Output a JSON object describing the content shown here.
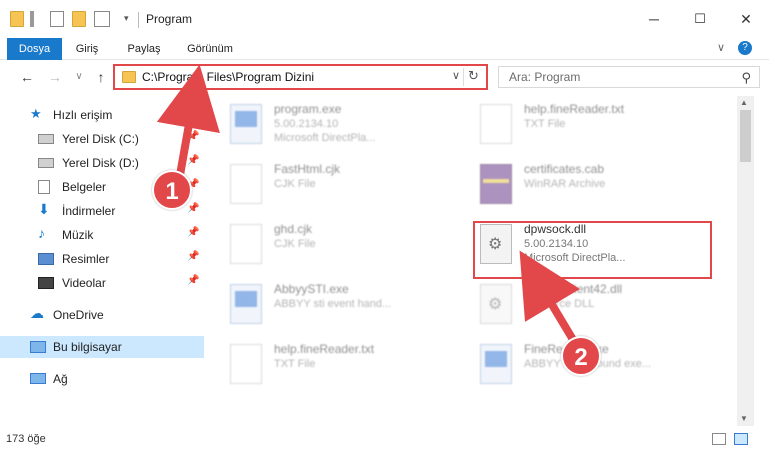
{
  "window": {
    "title": "Program",
    "minimize": "─",
    "maximize": "☐",
    "close": "✕"
  },
  "ribbon": {
    "tabs": [
      "Dosya",
      "Giriş",
      "Paylaş",
      "Görünüm"
    ],
    "collapse": "∨",
    "help": "?"
  },
  "nav": {
    "back": "←",
    "forward": "→",
    "recent": "∨",
    "up": "↑",
    "address": "C:\\Program Files\\Program Dizini",
    "address_dropdown": "∨",
    "refresh": "↻",
    "search_placeholder": "Ara: Program",
    "search_icon": "⚲"
  },
  "sidebar": {
    "quick_access": "Hızlı erişim",
    "items": [
      {
        "label": "Yerel Disk (C:)",
        "icon": "drive-icon"
      },
      {
        "label": "Yerel Disk (D:)",
        "icon": "drive-icon"
      },
      {
        "label": "Belgeler",
        "icon": "documents-icon"
      },
      {
        "label": "İndirmeler",
        "icon": "downloads-icon"
      },
      {
        "label": "Müzik",
        "icon": "music-icon"
      },
      {
        "label": "Resimler",
        "icon": "pictures-icon"
      },
      {
        "label": "Videolar",
        "icon": "videos-icon"
      }
    ],
    "onedrive": "OneDrive",
    "this_pc": "Bu bilgisayar",
    "network": "Ağ",
    "pin": "📌"
  },
  "files": [
    {
      "name": "program.exe",
      "type": "5.00.2134.10",
      "sub": "Microsoft DirectPla...",
      "icon": "exe"
    },
    {
      "name": "help.fineReader.txt",
      "type": "TXT File",
      "sub": "",
      "icon": "txt"
    },
    {
      "name": "FastHtml.cjk",
      "type": "CJK File",
      "sub": "",
      "icon": "txt"
    },
    {
      "name": "certificates.cab",
      "type": "WinRAR Archive",
      "sub": "",
      "icon": "cab"
    },
    {
      "name": "ghd.cjk",
      "type": "CJK File",
      "sub": "",
      "icon": "txt"
    },
    {
      "name": "dpwsock.dll",
      "type": "5.00.2134.10",
      "sub": "Microsoft DirectPla...",
      "icon": "dll"
    },
    {
      "name": "AbbyySTI.exe",
      "type": "ABBYY sti event hand...",
      "sub": "",
      "icon": "exe"
    },
    {
      "name": "UpdateClient42.dll",
      "type": "Resource DLL",
      "sub": "",
      "icon": "dll"
    },
    {
      "name": "help.fineReader.txt",
      "type": "TXT File",
      "sub": "",
      "icon": "txt"
    },
    {
      "name": "FineReader.exe",
      "type": "ABBYY background exe...",
      "sub": "",
      "icon": "exe"
    }
  ],
  "status": {
    "count": "173 öğe"
  },
  "annotations": [
    "1",
    "2"
  ],
  "colors": {
    "accent": "#1979ca",
    "highlight": "#e2474a",
    "selection": "#cce8ff"
  }
}
